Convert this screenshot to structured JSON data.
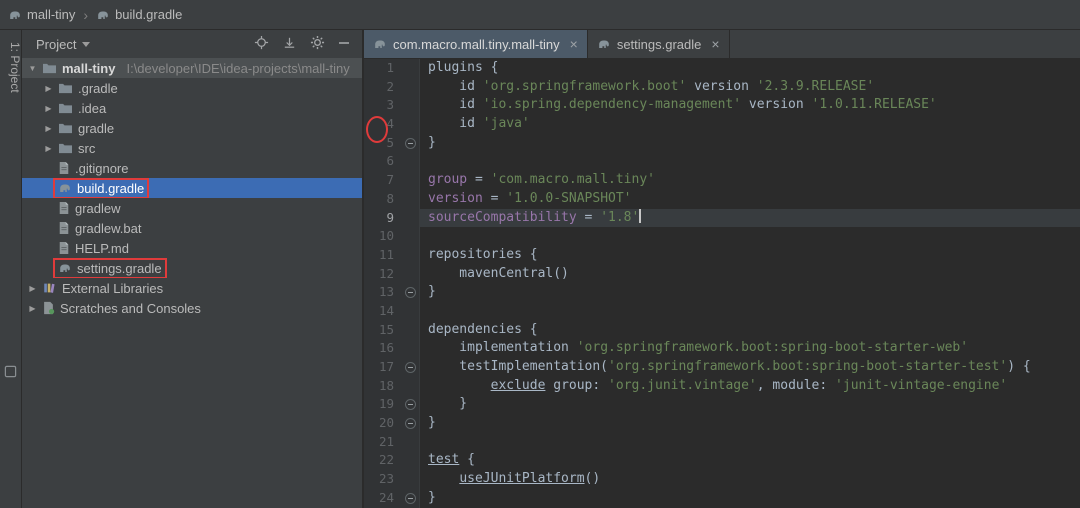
{
  "colors": {
    "panel_bg": "#3C3F41",
    "editor_bg": "#2B2B2B",
    "gutter_bg": "#313335",
    "gutter_text": "#606366",
    "plain": "#A9B7C6",
    "string": "#6A8759",
    "purple": "#9876AA",
    "selection_blue": "#3C6CB4",
    "inactive_sel": "#4C5052",
    "active_tab": "#4C5A68",
    "cur_line": "#383C3F",
    "annotation_red": "#E03B3B"
  },
  "topbar": {
    "separator": "›",
    "breadcrumbs": [
      {
        "icon": "gradle",
        "label": "mall-tiny"
      },
      {
        "icon": "gradle",
        "label": "build.gradle"
      }
    ]
  },
  "stripe": {
    "project_label": "1: Project"
  },
  "project_panel": {
    "title": "Project",
    "toolbar": [
      "locate",
      "collapse-all",
      "settings",
      "hide"
    ],
    "tree": [
      {
        "label": "mall-tiny",
        "path": "I:\\developer\\IDE\\idea-projects\\mall-tiny",
        "icon": "folder",
        "indent": 0,
        "arrow": "expanded",
        "selected": "inactive",
        "bold": true
      },
      {
        "label": ".gradle",
        "icon": "folder",
        "indent": 1,
        "arrow": "collapsed"
      },
      {
        "label": ".idea",
        "icon": "folder",
        "indent": 1,
        "arrow": "collapsed"
      },
      {
        "label": "gradle",
        "icon": "folder",
        "indent": 1,
        "arrow": "collapsed"
      },
      {
        "label": "src",
        "icon": "folder",
        "indent": 1,
        "arrow": "collapsed"
      },
      {
        "label": ".gitignore",
        "icon": "file",
        "indent": 1
      },
      {
        "label": "build.gradle",
        "icon": "gradle",
        "indent": 1,
        "selected": "active",
        "red_box": true
      },
      {
        "label": "gradlew",
        "icon": "file",
        "indent": 1
      },
      {
        "label": "gradlew.bat",
        "icon": "file",
        "indent": 1
      },
      {
        "label": "HELP.md",
        "icon": "file",
        "indent": 1
      },
      {
        "label": "settings.gradle",
        "icon": "gradle",
        "indent": 1,
        "red_box": true
      },
      {
        "label": "External Libraries",
        "icon": "library",
        "indent": 0,
        "arrow": "collapsed"
      },
      {
        "label": "Scratches and Consoles",
        "icon": "scratch",
        "indent": 0,
        "arrow": "collapsed"
      }
    ]
  },
  "editor": {
    "tabs": [
      {
        "icon": "gradle",
        "label": "com.macro.mall.tiny.mall-tiny",
        "active": true
      },
      {
        "icon": "gradle",
        "label": "settings.gradle",
        "active": false
      }
    ],
    "close_glyph": "×",
    "current_line": 9,
    "caret_line": 9,
    "fold_lines": [
      5,
      13,
      17,
      19,
      20,
      24
    ],
    "lines": [
      [
        [
          "plugins {",
          "p"
        ]
      ],
      [
        [
          "    id ",
          "p"
        ],
        [
          "'org.springframework.boot'",
          "s"
        ],
        [
          " version ",
          "p"
        ],
        [
          "'2.3.9.RELEASE'",
          "s"
        ]
      ],
      [
        [
          "    id ",
          "p"
        ],
        [
          "'io.spring.dependency-management'",
          "s"
        ],
        [
          " version ",
          "p"
        ],
        [
          "'1.0.11.RELEASE'",
          "s"
        ]
      ],
      [
        [
          "    id ",
          "p"
        ],
        [
          "'java'",
          "s"
        ]
      ],
      [
        [
          "}",
          "p"
        ]
      ],
      [],
      [
        [
          "group",
          "v"
        ],
        [
          " = ",
          "p"
        ],
        [
          "'com.macro.mall.tiny'",
          "s"
        ]
      ],
      [
        [
          "version",
          "v"
        ],
        [
          " = ",
          "p"
        ],
        [
          "'1.0.0-SNAPSHOT'",
          "s"
        ]
      ],
      [
        [
          "sourceCompatibility",
          "v"
        ],
        [
          " = ",
          "p"
        ],
        [
          "'1.8'",
          "s"
        ]
      ],
      [],
      [
        [
          "repositories {",
          "p"
        ]
      ],
      [
        [
          "    mavenCentral()",
          "p"
        ]
      ],
      [
        [
          "}",
          "p"
        ]
      ],
      [],
      [
        [
          "dependencies {",
          "p"
        ]
      ],
      [
        [
          "    implementation ",
          "p"
        ],
        [
          "'org.springframework.boot:spring-boot-starter-web'",
          "s"
        ]
      ],
      [
        [
          "    testImplementation(",
          "p"
        ],
        [
          "'org.springframework.boot:spring-boot-starter-test'",
          "s"
        ],
        [
          ") {",
          "p"
        ]
      ],
      [
        [
          "        ",
          "p"
        ],
        [
          "exclude",
          "u"
        ],
        [
          " group: ",
          "p"
        ],
        [
          "'org.junit.vintage'",
          "s"
        ],
        [
          ", module: ",
          "p"
        ],
        [
          "'junit-vintage-engine'",
          "s"
        ]
      ],
      [
        [
          "    }",
          "p"
        ]
      ],
      [
        [
          "}",
          "p"
        ]
      ],
      [],
      [
        [
          "test",
          "u"
        ],
        [
          " {",
          "p"
        ]
      ],
      [
        [
          "    ",
          "p"
        ],
        [
          "useJUnitPlatform",
          "u"
        ],
        [
          "()",
          "p"
        ]
      ],
      [
        [
          "}",
          "p"
        ]
      ]
    ]
  },
  "annotations": {
    "tree_red_boxes": [
      "build.gradle",
      "settings.gradle"
    ],
    "editor_red_circle_lines": "4-5"
  }
}
